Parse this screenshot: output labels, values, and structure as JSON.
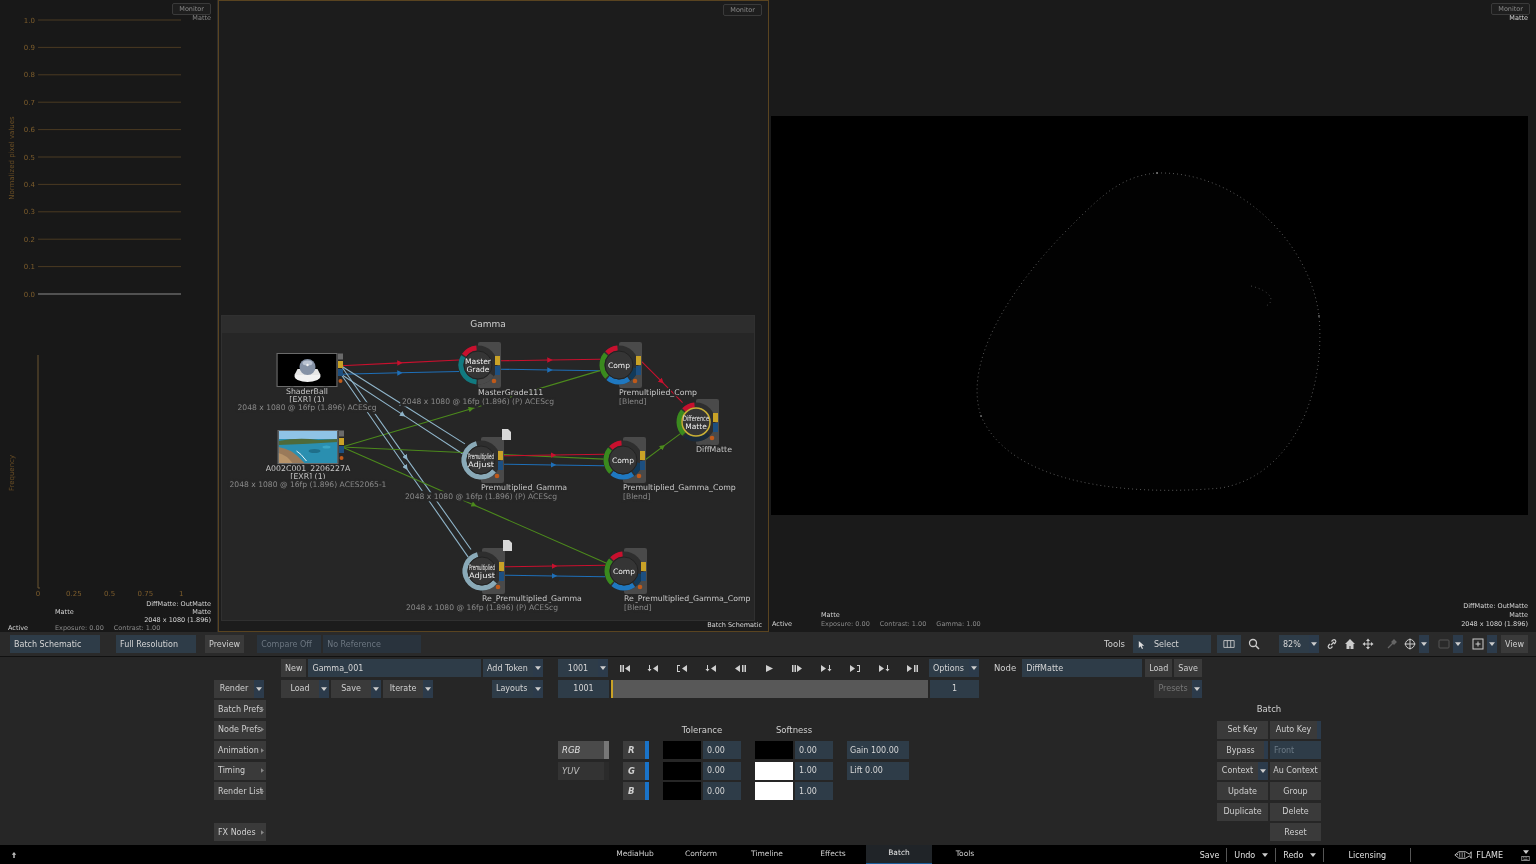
{
  "scope": {
    "monitor": "Monitor",
    "channel": "Matte",
    "waveform": {
      "ylabel": "Normalized pixel values",
      "y_axis_labels": [
        "1.0",
        "0.9",
        "0.8",
        "0.7",
        "0.6",
        "0.5",
        "0.4",
        "0.3",
        "0.2",
        "0.1",
        "0.0"
      ]
    },
    "histogram": {
      "ylabel": "Frequency",
      "x_axis_labels": [
        "0",
        "0.25",
        "0.5",
        "0.75",
        "1"
      ]
    },
    "footer": {
      "status": "Active",
      "channel": "Matte",
      "exposure": "Exposure: 0.00",
      "contrast": "Contrast: 1.00",
      "node": "DiffMatte: OutMatte",
      "output": "Matte",
      "resolution": "2048 x 1080 (1.896)"
    }
  },
  "schematic": {
    "monitor": "Monitor",
    "group": "Gamma",
    "footer": "Batch Schematic",
    "nodes": [
      {
        "kind": "clip",
        "name": "ShaderBall",
        "format": "[EXR] (1)",
        "info": "2048 x 1080 @ 16fp (1.896) ACEScg",
        "selected": false
      },
      {
        "kind": "clip",
        "name": "A002C001_2206227A",
        "format": "[EXR] (1)",
        "info": "2048 x 1080 @ 16fp (1.896) ACES2065-1",
        "selected": false
      },
      {
        "kind": "grade",
        "label": "Master Grade",
        "name": "MasterGrade111",
        "info": "2048 x 1080 @ 16fp (1.896) (P) ACEScg",
        "selected": false
      },
      {
        "kind": "comp",
        "label": "Comp",
        "name": "Premultiplied_Comp",
        "type": "[Blend]",
        "selected": false
      },
      {
        "kind": "matte",
        "label": "Difference Matte",
        "name": "DiffMatte",
        "selected": true
      },
      {
        "kind": "adjust",
        "label": "Premultiplied Adjust",
        "name": "Premultiplied_Gamma",
        "info": "2048 x 1080 @ 16fp (1.896) (P) ACEScg",
        "selected": false
      },
      {
        "kind": "comp",
        "label": "Comp",
        "name": "Premultiplied_Gamma_Comp",
        "type": "[Blend]",
        "selected": false
      },
      {
        "kind": "adjust",
        "label": "Premultiplied Adjust",
        "name": "Re_Premultiplied_Gamma",
        "info": "2048 x 1080 @ 16fp (1.896) (P) ACEScg",
        "selected": false
      },
      {
        "kind": "comp",
        "label": "Comp",
        "name": "Re_Premultiplied_Gamma_Comp",
        "type": "[Blend]",
        "selected": false
      }
    ]
  },
  "viewer": {
    "monitor": "Monitor",
    "channel": "Matte",
    "footer": {
      "status": "Active",
      "channel": "Matte",
      "exposure": "Exposure: 0.00",
      "contrast": "Contrast: 1.00",
      "gamma": "Gamma: 1.00",
      "node": "DiffMatte: OutMatte",
      "output": "Matte",
      "resolution": "2048 x 1080 (1.896)"
    }
  },
  "view_bar": {
    "schematic_menu": "Batch Schematic",
    "resolution": "Full Resolution",
    "preview": "Preview",
    "compare": {
      "label": "Compare Off",
      "disabled": true
    },
    "reference": {
      "label": "No Reference",
      "disabled": true
    },
    "tools_label": "Tools",
    "tool": "Select",
    "zoom": "82%",
    "view": "View"
  },
  "batch_controls": {
    "side_buttons": [
      {
        "label": "Render",
        "kind": "dropdown"
      },
      {
        "label": "Batch Prefs",
        "kind": "submenu"
      },
      {
        "label": "Node Prefs",
        "kind": "submenu"
      },
      {
        "label": "Animation",
        "kind": "submenu"
      },
      {
        "label": "Timing",
        "kind": "submenu"
      },
      {
        "label": "Render List",
        "kind": "submenu"
      },
      {
        "label": "FX Nodes",
        "kind": "submenu"
      }
    ],
    "setup": {
      "new": "New",
      "name": "Gamma_001",
      "add_token": "Add Token",
      "load": "Load",
      "save": "Save",
      "iterate": "Iterate",
      "layouts": "Layouts"
    },
    "transport": {
      "frame": "1001",
      "options": "Options",
      "start": "1001",
      "end": "1"
    },
    "node": {
      "label": "Node",
      "name": "DiffMatte",
      "load": "Load",
      "save": "Save",
      "presets": {
        "label": "Presets",
        "disabled": true
      }
    },
    "key": {
      "modes": [
        {
          "label": "RGB",
          "selected": true
        },
        {
          "label": "YUV",
          "selected": false
        }
      ],
      "channels": [
        {
          "label": "R",
          "on": true
        },
        {
          "label": "G",
          "on": true
        },
        {
          "label": "B",
          "on": true
        }
      ],
      "tolerance": {
        "title": "Tolerance",
        "rows": [
          {
            "color": "#000000",
            "value": "0.00"
          },
          {
            "color": "#000000",
            "value": "0.00"
          },
          {
            "color": "#000000",
            "value": "0.00"
          }
        ]
      },
      "softness": {
        "title": "Softness",
        "rows": [
          {
            "color": "#000000",
            "value": "0.00"
          },
          {
            "color": "#ffffff",
            "value": "1.00"
          },
          {
            "color": "#ffffff",
            "value": "1.00"
          }
        ]
      },
      "gain": "Gain 100.00",
      "lift": "Lift 0.00"
    },
    "batch": {
      "title": "Batch",
      "buttons": [
        {
          "label": "Set Key",
          "kind": "button"
        },
        {
          "label": "Auto Key",
          "kind": "toggle",
          "on": false
        },
        {
          "label": "Bypass",
          "kind": "toggle",
          "on": false
        },
        {
          "placeholder": "Front",
          "kind": "field"
        },
        {
          "label": "Context",
          "kind": "dropdown"
        },
        {
          "label": "Au Context",
          "kind": "button"
        },
        {
          "label": "Update",
          "kind": "button"
        },
        {
          "label": "Group",
          "kind": "button"
        },
        {
          "label": "Duplicate",
          "kind": "button"
        },
        {
          "label": "Delete",
          "kind": "button"
        },
        {
          "label": "Reset",
          "kind": "button"
        }
      ]
    }
  },
  "tabs": [
    {
      "label": "MediaHub",
      "selected": false
    },
    {
      "label": "Conform",
      "selected": false
    },
    {
      "label": "Timeline",
      "selected": false
    },
    {
      "label": "Effects",
      "selected": false
    },
    {
      "label": "Batch",
      "selected": true
    },
    {
      "label": "Tools",
      "selected": false
    }
  ],
  "status_bar": {
    "save": "Save",
    "undo": "Undo",
    "redo": "Redo",
    "licensing": "Licensing",
    "product": "FLAME"
  }
}
